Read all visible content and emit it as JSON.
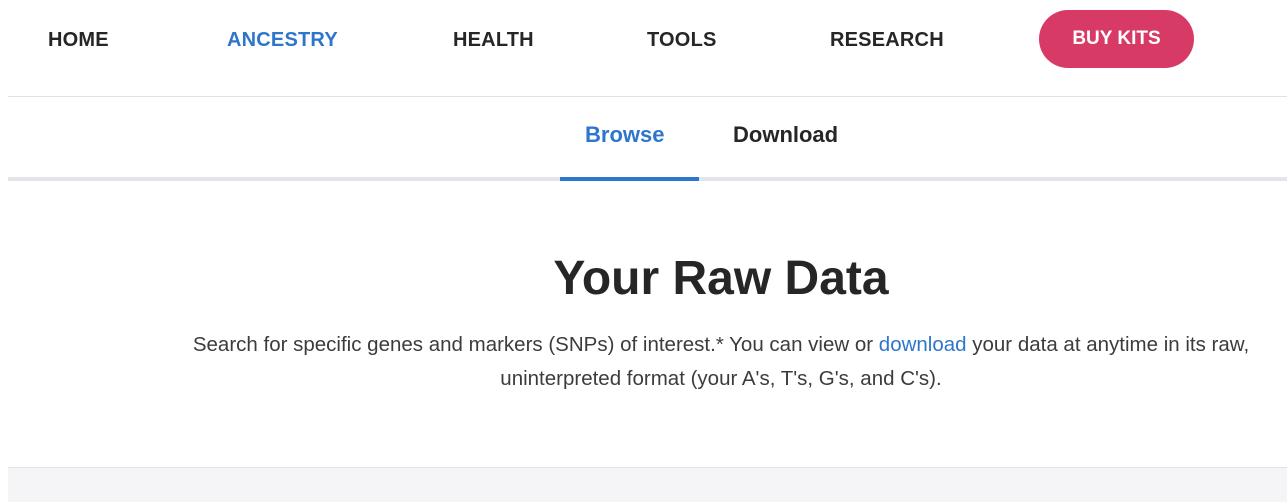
{
  "nav": {
    "items": [
      {
        "id": "nav-home",
        "label": "HOME",
        "active": false
      },
      {
        "id": "nav-ancestry",
        "label": "ANCESTRY",
        "active": true
      },
      {
        "id": "nav-health",
        "label": "HEALTH",
        "active": false
      },
      {
        "id": "nav-tools",
        "label": "TOOLS",
        "active": false
      },
      {
        "id": "nav-research",
        "label": "RESEARCH",
        "active": false
      }
    ],
    "cta_label": "BUY KITS"
  },
  "tabs": {
    "browse_label": "Browse",
    "download_label": "Download",
    "active": "Browse"
  },
  "hero": {
    "title": "Your Raw Data",
    "description_before_link": "Search for specific genes and markers (SNPs) of interest.* You can view or ",
    "description_link": "download",
    "description_after_link": " your data at anytime in its raw, uninterpreted format (your A's, T's, G's, and C's)."
  },
  "colors": {
    "accent": "#2e76cc",
    "cta": "#d83a66",
    "text": "#262626",
    "divider": "#e2e2e2",
    "panel": "#f5f5f7"
  }
}
